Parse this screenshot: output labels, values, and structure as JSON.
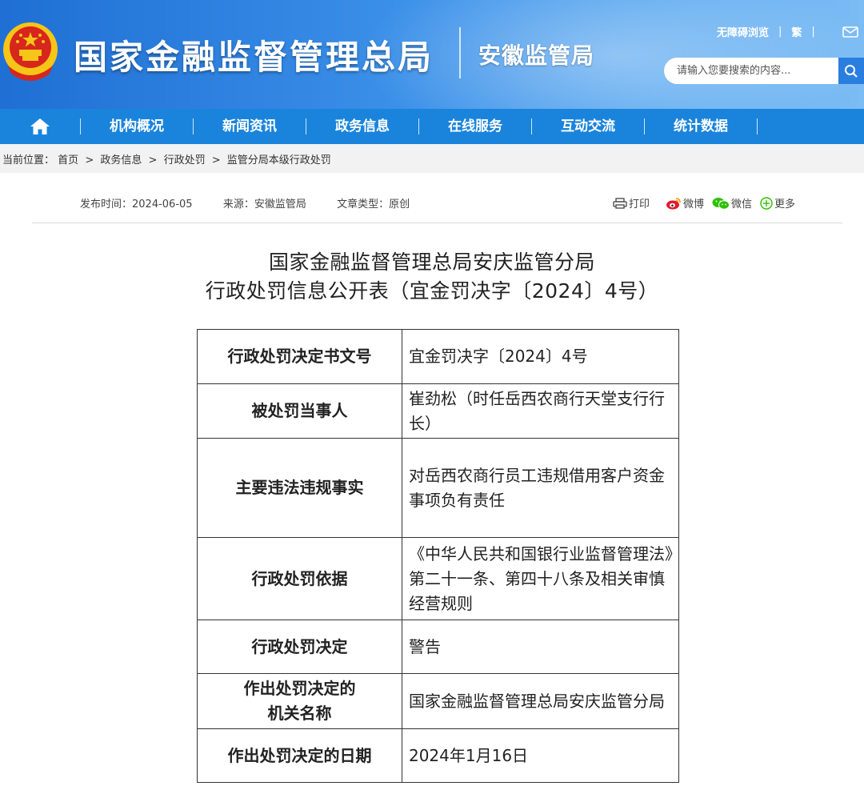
{
  "header": {
    "site_title": "国家金融监督管理总局",
    "sub_title": "安徽监管局",
    "accessibility_link": "无障碍浏览",
    "traditional_link": "繁",
    "mail_icon": "mail-icon",
    "emblem_icon": "national-emblem-icon",
    "search": {
      "placeholder": "请输入您要搜索的内容...",
      "icon": "search-icon"
    }
  },
  "nav": {
    "home_icon": "home-icon",
    "items": [
      {
        "label": "机构概况"
      },
      {
        "label": "新闻资讯"
      },
      {
        "label": "政务信息"
      },
      {
        "label": "在线服务"
      },
      {
        "label": "互动交流"
      },
      {
        "label": "统计数据"
      }
    ]
  },
  "breadcrumb": {
    "prefix": "当前位置：",
    "items": [
      "首页",
      "政务信息",
      "行政处罚",
      "监管分局本级行政处罚"
    ],
    "separator": ">"
  },
  "meta": {
    "publish_time": "发布时间：2024-06-05",
    "source": "来源：安徽监管局",
    "article_type": "文章类型：原创"
  },
  "share": {
    "print": "打印",
    "weibo": "微博",
    "wechat": "微信",
    "more": "更多"
  },
  "document": {
    "title_line1": "国家金融监督管理总局安庆监管分局",
    "title_line2": "行政处罚信息公开表（宜金罚决字〔2024〕4号）",
    "rows": [
      {
        "key": "行政处罚决定书文号",
        "value": "宜金罚决字〔2024〕4号"
      },
      {
        "key": "被处罚当事人",
        "value": "崔劲松（时任岳西农商行天堂支行行长）"
      },
      {
        "key": "主要违法违规事实",
        "value": "对岳西农商行员工违规借用客户资金事项负有责任"
      },
      {
        "key": "行政处罚依据",
        "value": "《中华人民共和国银行业监督管理法》第二十一条、第四十八条及相关审慎经营规则"
      },
      {
        "key": "行政处罚决定",
        "value": "警告"
      },
      {
        "key_line1": "作出处罚决定的",
        "key_line2": "机关名称",
        "value": "国家金融监督管理总局安庆监管分局"
      },
      {
        "key": "作出处罚决定的日期",
        "value": "2024年1月16日"
      }
    ]
  },
  "colors": {
    "header_blue": "#1f6fd4",
    "nav_blue": "#1a84dc",
    "page_bg": "#f2f2f2",
    "emblem_red": "#d7261c",
    "emblem_gold": "#f5c518"
  }
}
